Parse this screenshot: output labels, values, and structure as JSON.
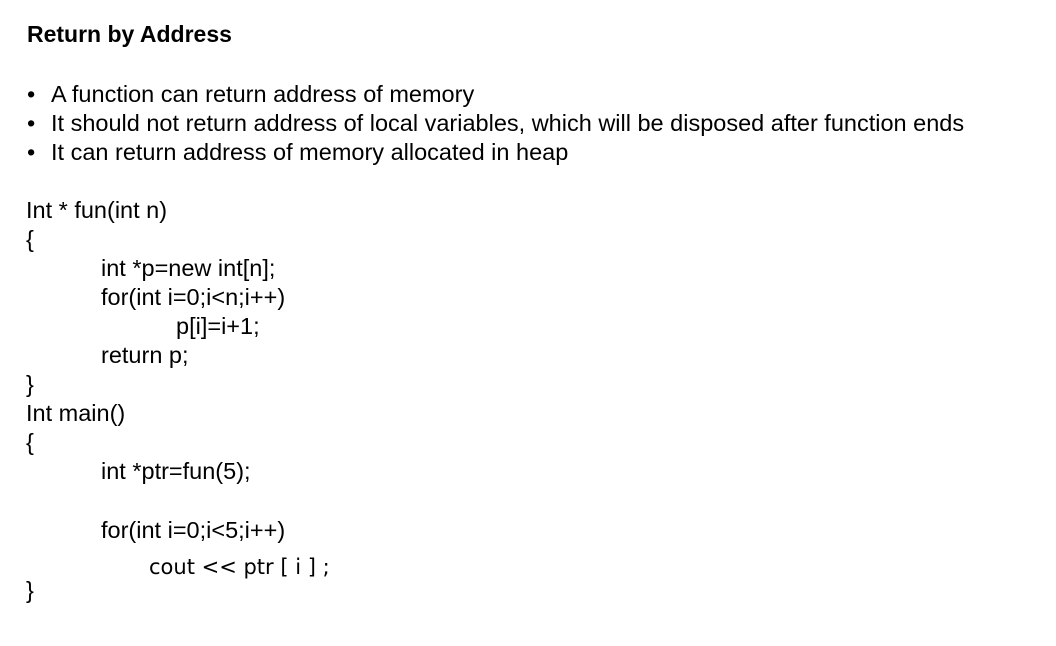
{
  "slide": {
    "title": "Return by Address",
    "bullets": [
      "A function can return address of memory",
      "It should not return address of local variables, which will be disposed after function ends",
      "It can return address of memory allocated in heap"
    ],
    "bullet_symbol": "•",
    "code_lines": [
      "Int * fun(int n)",
      "{",
      "int *p=new int[n];",
      "for(int i=0;i<n;i++)",
      "p[i]=i+1;",
      "return p;",
      "}",
      "Int main()",
      "{",
      "int *ptr=fun(5);",
      "for(int i=0;i<5;i++)",
      "cout << ptr [ i ] ;",
      "}"
    ]
  }
}
